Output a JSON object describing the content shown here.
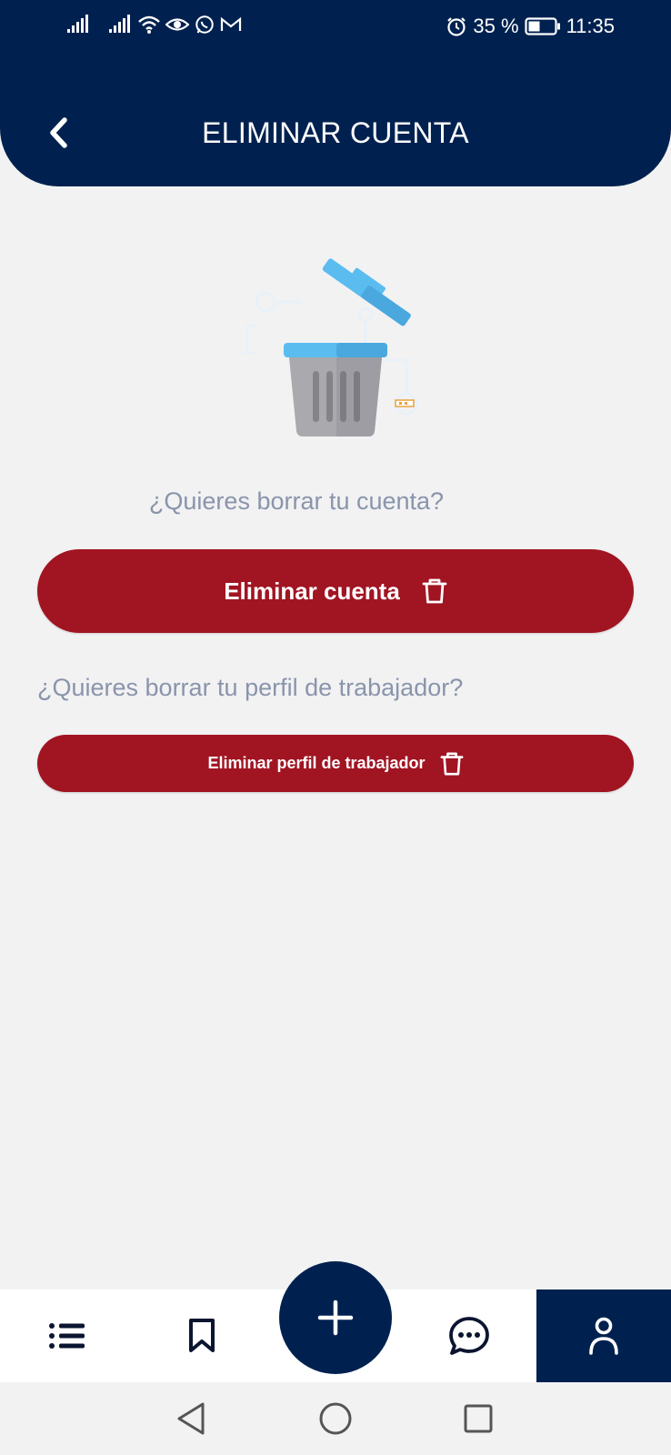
{
  "status_bar": {
    "battery_percent": "35 %",
    "time": "11:35",
    "icons": [
      "signal-icon",
      "signal-icon",
      "wifi-icon",
      "eye-icon",
      "whatsapp-icon",
      "gmail-icon",
      "alarm-icon",
      "battery-icon"
    ]
  },
  "header": {
    "title": "ELIMINAR CUENTA",
    "back_icon": "chevron-left-icon"
  },
  "main": {
    "illustration": "trash-can-illustration",
    "delete_account_question": "¿Quieres borrar tu cuenta?",
    "delete_account_button": "Eliminar cuenta",
    "delete_worker_question": "¿Quieres borrar tu perfil de trabajador?",
    "delete_worker_button": "Eliminar perfil de trabajador"
  },
  "bottom_nav": {
    "items": [
      "list-icon",
      "bookmark-icon",
      "add-icon",
      "chat-icon",
      "profile-icon"
    ],
    "active": "profile-icon"
  },
  "system_nav": [
    "back-triangle-icon",
    "home-circle-icon",
    "recents-square-icon"
  ],
  "colors": {
    "primary_navy": "#00214f",
    "danger_red": "#a11422",
    "question_text": "#8a94ab",
    "background": "#f2f2f3"
  }
}
